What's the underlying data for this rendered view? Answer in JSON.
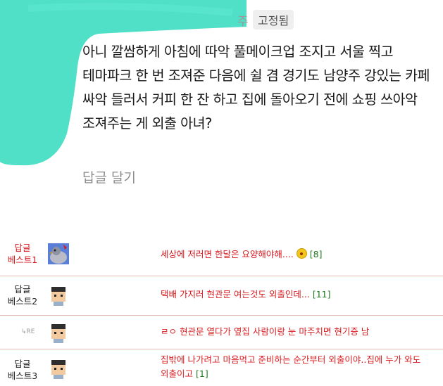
{
  "comment": {
    "author_tail": "주",
    "pinned_badge": "고정됨",
    "body": "아니 깔쌈하게 아침에 따악 풀메이크업 조지고 서울 찍고 테마파크 한 번 조져준 다음에 쉴 겸 경기도 남양주 강있는 카페 싸악 들러서 커피 한 잔 하고 집에 돌아오기 전에 쇼핑 쓰아악 조져주는 게 외출 아녀?",
    "reply_link": "답글 달기"
  },
  "best_comments": [
    {
      "rank_label_1": "답글",
      "rank_label_2": "베스트1",
      "text": "세상에 저러면 한달은 요양해야해....",
      "count": "[8]"
    },
    {
      "rank_label_1": "답글",
      "rank_label_2": "베스트2",
      "text": "택배 가지러 현관문 여는것도 외출인데...",
      "count": "[11]"
    },
    {
      "reply_marker": "RE",
      "text": "ㄹㅇ 현관문 열다가 옆집 사람이랑 눈 마주치면 현기증 남",
      "count": ""
    },
    {
      "rank_label_1": "답글",
      "rank_label_2": "베스트3",
      "text": "집밖에 나가려고 마음먹고 준비하는 순간부터 외출이야..집에 누가 와도 외출이고",
      "count": "[1]"
    }
  ],
  "colors": {
    "scribble": "#4fe0c7",
    "accent_red": "#d7191e",
    "count_green": "#1f7a1f"
  },
  "icons": [
    "pigeon-avatar",
    "pixel-person-avatar",
    "reply-arrow-icon",
    "shocked-emoji-icon"
  ]
}
